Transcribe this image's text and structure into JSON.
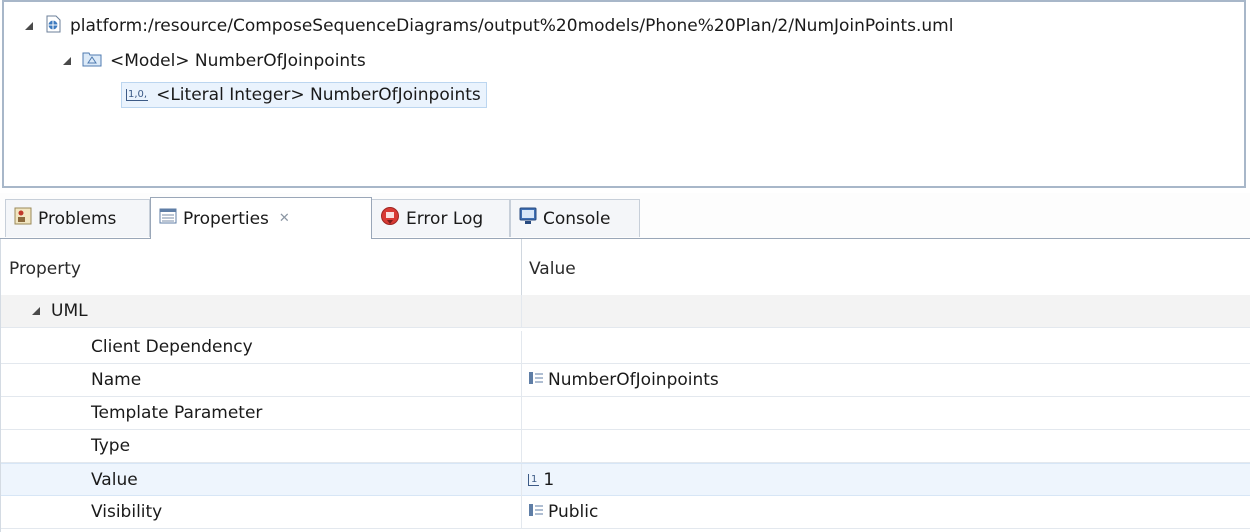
{
  "tree": {
    "root_label": "platform:/resource/ComposeSequenceDiagrams/output%20models/Phone%20Plan/2/NumJoinPoints.uml",
    "model_label": "<Model> NumberOfJoinpoints",
    "literal_label": "<Literal Integer> NumberOfJoinpoints",
    "literal_icon_text": "1,0,"
  },
  "tabs": [
    {
      "label": "Problems",
      "icon": "problems-icon"
    },
    {
      "label": "Properties",
      "icon": "properties-icon",
      "close": "✕"
    },
    {
      "label": "Error Log",
      "icon": "error-log-icon"
    },
    {
      "label": "Console",
      "icon": "console-icon"
    }
  ],
  "table": {
    "col_property": "Property",
    "col_value": "Value",
    "category": "UML",
    "rows": [
      {
        "name": "Client Dependency",
        "value": ""
      },
      {
        "name": "Name",
        "value": "NumberOfJoinpoints",
        "icon": "list-icon"
      },
      {
        "name": "Template Parameter",
        "value": ""
      },
      {
        "name": "Type",
        "value": ""
      },
      {
        "name": "Value",
        "value": "1",
        "icon": "integer-icon",
        "icon_text": "1"
      },
      {
        "name": "Visibility",
        "value": "Public",
        "icon": "list-icon"
      }
    ]
  },
  "colors": {
    "selection_bg": "#eaf3fd",
    "panel_border": "#a8b7c9"
  }
}
